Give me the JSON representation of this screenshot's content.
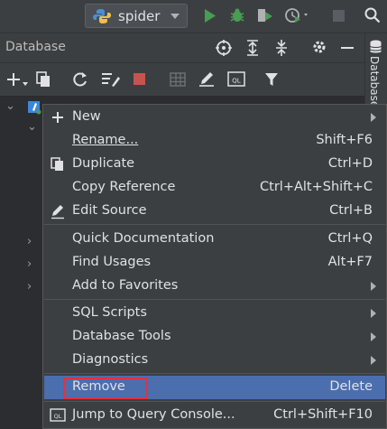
{
  "toolbar": {
    "run_config": "spider"
  },
  "panel": {
    "title": "Database",
    "side_tab_label": "Database"
  },
  "menu": {
    "items": [
      {
        "label": "New",
        "shortcut": "",
        "submenu": true
      },
      {
        "label": "Rename...",
        "shortcut": "Shift+F6"
      },
      {
        "label": "Duplicate",
        "shortcut": "Ctrl+D"
      },
      {
        "label": "Copy Reference",
        "shortcut": "Ctrl+Alt+Shift+C"
      },
      {
        "label": "Edit Source",
        "shortcut": "Ctrl+B"
      },
      {
        "label": "Quick Documentation",
        "shortcut": "Ctrl+Q"
      },
      {
        "label": "Find Usages",
        "shortcut": "Alt+F7"
      },
      {
        "label": "Add to Favorites",
        "shortcut": "",
        "submenu": true
      },
      {
        "label": "SQL Scripts",
        "shortcut": "",
        "submenu": true
      },
      {
        "label": "Database Tools",
        "shortcut": "",
        "submenu": true
      },
      {
        "label": "Diagnostics",
        "shortcut": "",
        "submenu": true
      },
      {
        "label": "Remove",
        "shortcut": "Delete"
      },
      {
        "label": "Jump to Query Console...",
        "shortcut": "Ctrl+Shift+F10"
      }
    ]
  },
  "colors": {
    "selection": "#4b6eaf",
    "highlight_box": "#e5303d",
    "run_green": "#499c54"
  }
}
